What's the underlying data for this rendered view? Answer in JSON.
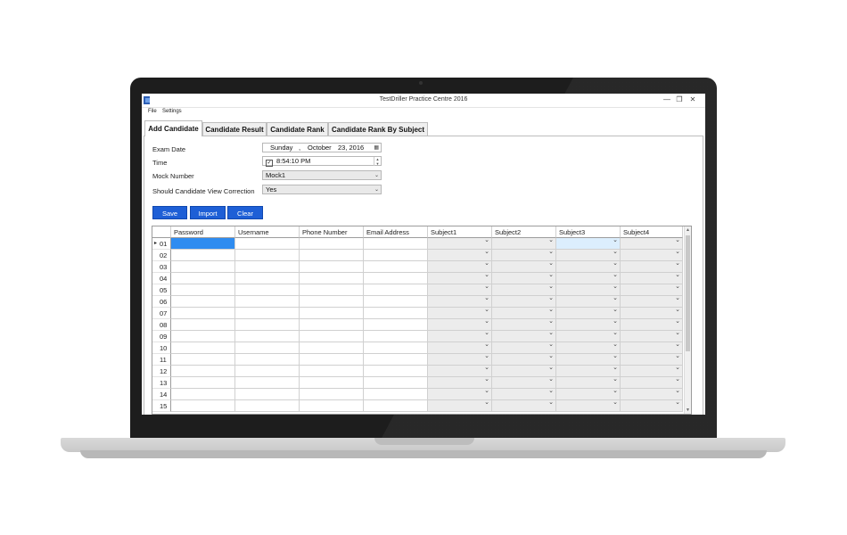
{
  "window": {
    "title": "TestDriller Practice Centre 2016",
    "min_glyph": "—",
    "max_glyph": "❐",
    "close_glyph": "✕",
    "app_icon": "app-logo-icon"
  },
  "menu": [
    "File",
    "Settings"
  ],
  "tabs": [
    "Add Candidate",
    "Candidate Result",
    "Candidate Rank",
    "Candidate Rank By Subject"
  ],
  "active_tab": "Add Candidate",
  "form": {
    "exam_date": {
      "label": "Exam Date",
      "day": "Sunday",
      "sep": ",",
      "month": "October",
      "date": "23, 2016"
    },
    "time": {
      "label": "Time",
      "checked": "✓",
      "value": "8:54:10 PM"
    },
    "mock_number": {
      "label": "Mock Number",
      "value": "Mock1"
    },
    "view_correction": {
      "label": "Should Candidate View Correction",
      "value": "Yes"
    }
  },
  "buttons": {
    "save": "Save",
    "import": "Import",
    "clear": "Clear"
  },
  "grid": {
    "columns": [
      "Password",
      "Username",
      "Phone Number",
      "Email Address",
      "Subject1",
      "Subject2",
      "Subject3",
      "Subject4"
    ],
    "rows": [
      "01",
      "02",
      "03",
      "04",
      "05",
      "06",
      "07",
      "08",
      "09",
      "10",
      "11",
      "12",
      "13",
      "14",
      "15"
    ],
    "current_row_marker": "▸"
  },
  "colors": {
    "accent": "#1e5fd6",
    "selected_cell": "#2f8cf0"
  }
}
